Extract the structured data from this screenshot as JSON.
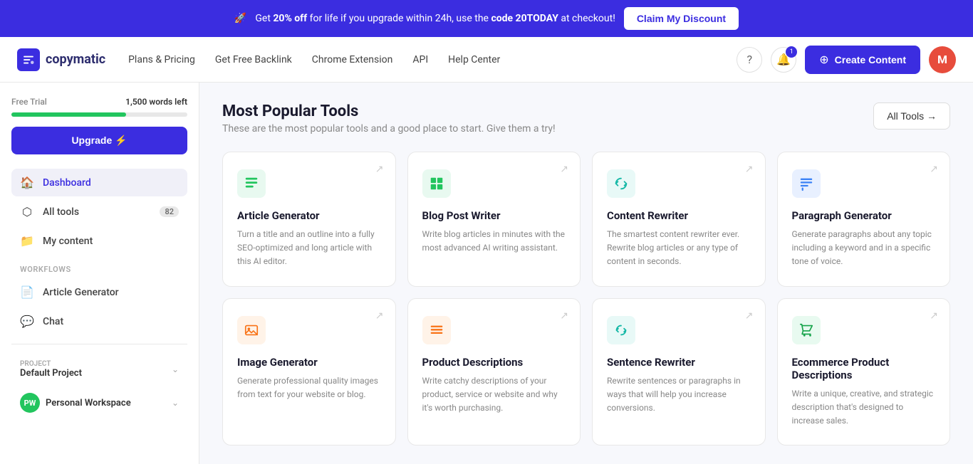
{
  "banner": {
    "text_before": "Get ",
    "highlight": "20% off",
    "text_after": " for life if you upgrade within 24h, use the ",
    "code_label": "code 20TODAY",
    "text_end": " at checkout!",
    "cta": "Claim My Discount",
    "rocket_icon": "🚀"
  },
  "header": {
    "logo_text": "copymatic",
    "nav": [
      {
        "label": "Plans & Pricing",
        "id": "plans"
      },
      {
        "label": "Get Free Backlink",
        "id": "backlink"
      },
      {
        "label": "Chrome Extension",
        "id": "chrome"
      },
      {
        "label": "API",
        "id": "api"
      },
      {
        "label": "Help Center",
        "id": "help"
      }
    ],
    "notification_count": "1",
    "create_btn": "Create Content",
    "plus_icon": "+",
    "avatar_letter": "M"
  },
  "sidebar": {
    "trial_label": "Free Trial",
    "words_left": "1,500 words left",
    "progress_pct": 65,
    "upgrade_btn": "Upgrade ⚡",
    "nav_items": [
      {
        "label": "Dashboard",
        "icon": "🏠",
        "active": true,
        "badge": null
      },
      {
        "label": "All tools",
        "icon": "⬡",
        "active": false,
        "badge": "82"
      },
      {
        "label": "My content",
        "icon": "📁",
        "active": false,
        "badge": null
      }
    ],
    "workflows_label": "Workflows",
    "workflow_items": [
      {
        "label": "Article Generator",
        "icon": "📄"
      },
      {
        "label": "Chat",
        "icon": "💬"
      }
    ],
    "project_label": "PROJECT",
    "project_name": "Default Project",
    "workspace_initials": "PW",
    "workspace_name": "Personal Workspace"
  },
  "main": {
    "title": "Most Popular Tools",
    "subtitle": "These are the most popular tools and a good place to start. Give them a try!",
    "all_tools_btn": "All Tools →",
    "tools": [
      {
        "id": "article-generator",
        "title": "Article Generator",
        "desc": "Turn a title and an outline into a fully SEO-optimized and long article with this AI editor.",
        "icon": "📝",
        "icon_class": "green"
      },
      {
        "id": "blog-post-writer",
        "title": "Blog Post Writer",
        "desc": "Write blog articles in minutes with the most advanced AI writing assistant.",
        "icon": "📊",
        "icon_class": "green"
      },
      {
        "id": "content-rewriter",
        "title": "Content Rewriter",
        "desc": "The smartest content rewriter ever. Rewrite blog articles or any type of content in seconds.",
        "icon": "🔄",
        "icon_class": "teal"
      },
      {
        "id": "paragraph-generator",
        "title": "Paragraph Generator",
        "desc": "Generate paragraphs about any topic including a keyword and in a specific tone of voice.",
        "icon": "📋",
        "icon_class": "blue"
      },
      {
        "id": "image-generator",
        "title": "Image Generator",
        "desc": "Generate professional quality images from text for your website or blog.",
        "icon": "🖼️",
        "icon_class": "orange"
      },
      {
        "id": "product-descriptions",
        "title": "Product Descriptions",
        "desc": "Write catchy descriptions of your product, service or website and why it's worth purchasing.",
        "icon": "☰",
        "icon_class": "orange"
      },
      {
        "id": "sentence-rewriter",
        "title": "Sentence Rewriter",
        "desc": "Rewrite sentences or paragraphs in ways that will help you increase conversions.",
        "icon": "🔁",
        "icon_class": "teal"
      },
      {
        "id": "ecommerce-product-descriptions",
        "title": "Ecommerce Product Descriptions",
        "desc": "Write a unique, creative, and strategic description that's designed to increase sales.",
        "icon": "🛒",
        "icon_class": "cart"
      }
    ]
  }
}
